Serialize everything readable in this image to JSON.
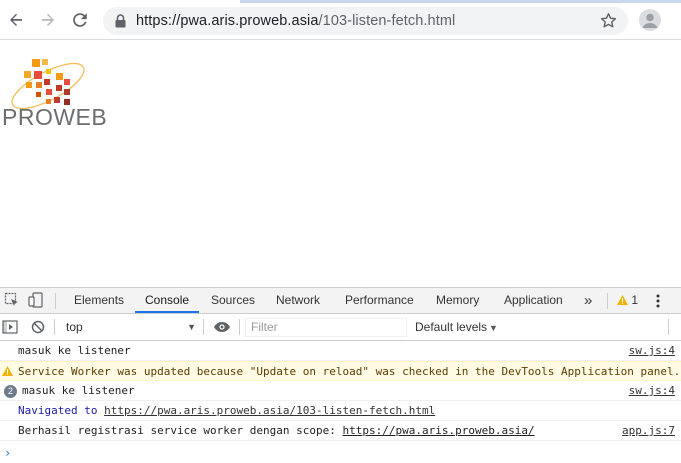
{
  "browser": {
    "url_host": "https://pwa.aris.proweb.asia",
    "url_path": "/103-listen-fetch.html"
  },
  "page": {
    "logo_text": "PROWEB"
  },
  "devtools": {
    "tabs": [
      "Elements",
      "Console",
      "Sources",
      "Network",
      "Performance",
      "Memory",
      "Application"
    ],
    "active_tab": "Console",
    "more_tabs": "»",
    "warning_count": "1",
    "context": "top",
    "filter_placeholder": "Filter",
    "levels_label": "Default levels"
  },
  "console": {
    "rows": [
      {
        "type": "log",
        "text": "masuk ke listener",
        "source": "sw.js:4"
      },
      {
        "type": "warning",
        "text": "Service Worker was updated because \"Update on reload\" was checked in the DevTools Application panel.",
        "source": ""
      },
      {
        "type": "log",
        "count": "2",
        "text": "masuk ke listener",
        "source": "sw.js:4"
      },
      {
        "type": "nav",
        "prefix": "Navigated to ",
        "link": "https://pwa.aris.proweb.asia/103-listen-fetch.html",
        "source": ""
      },
      {
        "type": "log",
        "prefix": "Berhasil registrasi service worker dengan scope: ",
        "link": "https://pwa.aris.proweb.asia/",
        "source": "app.js:7"
      }
    ],
    "prompt": "›"
  },
  "colors": {
    "accent": "#1a73e8",
    "warning_bg": "#fffbe5",
    "warning_icon": "#f0b400"
  }
}
